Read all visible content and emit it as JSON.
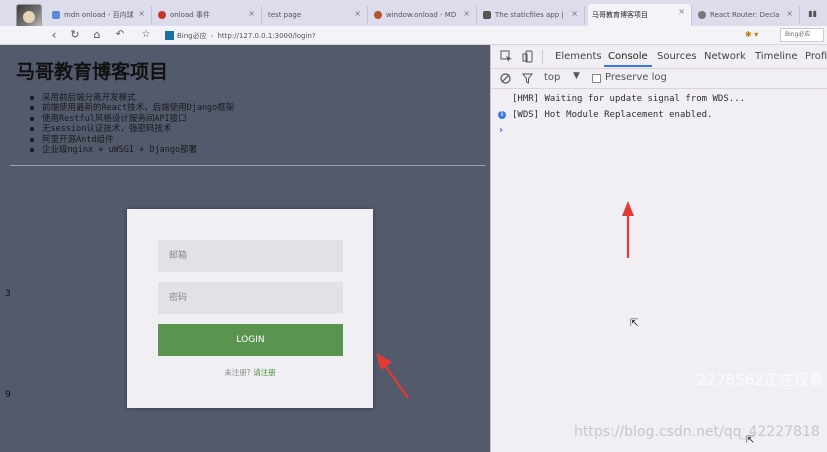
{
  "browser": {
    "tabs": [
      {
        "label": "mdn onload - 百内球 Bing",
        "favicon_color": "#5b8bd6"
      },
      {
        "label": "onload 事件",
        "favicon_color": "#c0392b"
      },
      {
        "label": "test page",
        "favicon_color": "#dcdcec"
      },
      {
        "label": "window.onload - MDN",
        "favicon_color": "#b8542c"
      },
      {
        "label": "The staticfiles app | Djan...",
        "favicon_color": "#555555"
      },
      {
        "label": "马哥教育博客项目",
        "favicon_color": "#dcdcec"
      },
      {
        "label": "React Router: Declarative...",
        "favicon_color": "#777777"
      }
    ],
    "url_search_engine": "Bing必应",
    "url": "http://127.0.0.1:3000/login?",
    "search_box": "Bing必应"
  },
  "page": {
    "title": "马哥教育博客项目",
    "features": [
      "采用前后端分离开发模式",
      "前端使用最新的React技术，后端使用Django框架",
      "使用Restful风格设计服务间API接口",
      "无session认证技术，强密码技术",
      "阿里开源Antd组件",
      "企业级nginx + uWSGI + Django部署"
    ],
    "margin_numbers": [
      "3",
      "9"
    ],
    "login": {
      "email_placeholder": "邮箱",
      "password_placeholder": "密码",
      "button_label": "LOGIN",
      "register_prompt": "未注册?",
      "register_link": "请注册"
    }
  },
  "devtools": {
    "tabs": [
      "Elements",
      "Console",
      "Sources",
      "Network",
      "Timeline",
      "Profil"
    ],
    "active_tab": "Console",
    "context": "top",
    "preserve_log_label": "Preserve log",
    "console_lines": [
      "[HMR] Waiting for update signal from WDS...",
      "[WDS] Hot Module Replacement enabled."
    ],
    "prompt": "›"
  },
  "overlay": {
    "watermark_viewers": "2278562正在观看",
    "watermark_url": "https://blog.csdn.net/qq_42227818"
  },
  "colors": {
    "page_bg": "#525a6c",
    "login_button": "#5b9350",
    "devtools_accent": "#3b78e7",
    "arrow": "#e53935"
  }
}
